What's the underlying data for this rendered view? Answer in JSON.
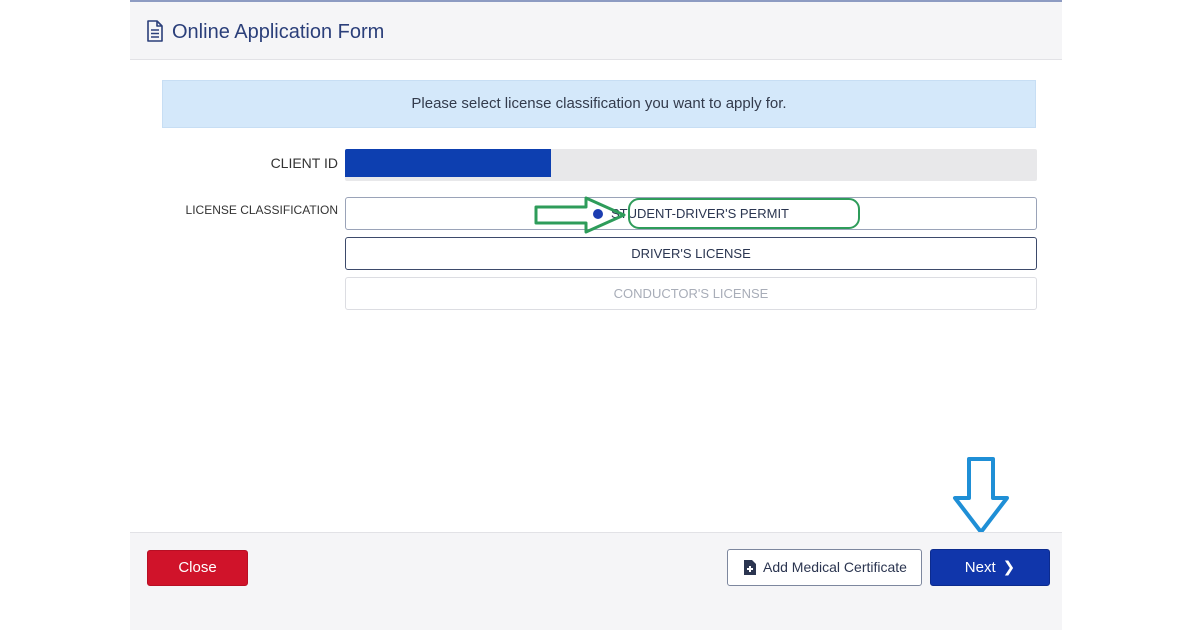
{
  "header": {
    "title": "Online Application Form",
    "icon": "document-icon"
  },
  "banner": {
    "text": "Please select license classification you want to apply for."
  },
  "client_id": {
    "label": "CLIENT ID",
    "value_redacted": true,
    "fill_fraction": 0.3
  },
  "license_classification": {
    "label": "LICENSE CLASSIFICATION",
    "options": [
      {
        "label": "STUDENT-DRIVER'S PERMIT",
        "selected": true,
        "enabled": true
      },
      {
        "label": "DRIVER'S LICENSE",
        "selected": false,
        "enabled": true
      },
      {
        "label": "CONDUCTOR'S LICENSE",
        "selected": false,
        "enabled": false
      }
    ]
  },
  "footer": {
    "close_label": "Close",
    "medical_label": "Add Medical Certificate",
    "medical_icon": "file-plus-icon",
    "next_label": "Next",
    "next_icon": "chevron-right-icon"
  },
  "colors": {
    "primary": "#1036ab",
    "danger": "#d0132a",
    "banner_bg": "#d4e8fa",
    "annotation_green": "#2e9c5a",
    "annotation_blue": "#1f8fd6"
  }
}
